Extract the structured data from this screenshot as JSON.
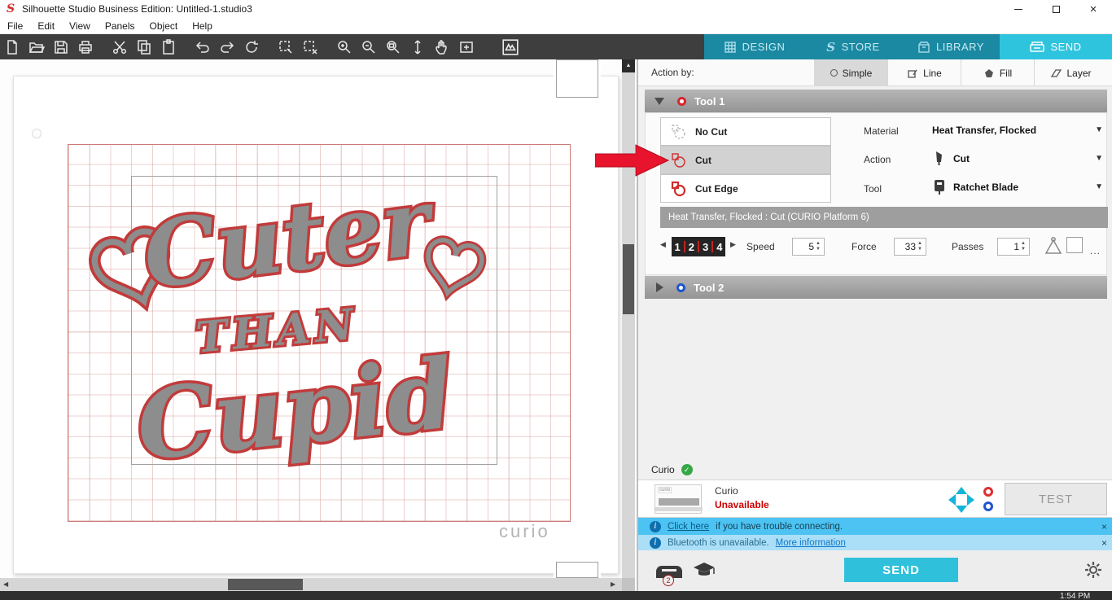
{
  "titlebar": {
    "title": "Silhouette Studio Business Edition: Untitled-1.studio3"
  },
  "menubar": {
    "items": [
      "File",
      "Edit",
      "View",
      "Panels",
      "Object",
      "Help"
    ]
  },
  "tabs": {
    "design": "DESIGN",
    "store": "STORE",
    "library": "LIBRARY",
    "send": "SEND"
  },
  "colors": {
    "accent_cyan": "#2fc1dc",
    "tab_teal": "#1b89a2",
    "alert_red": "#e8132c",
    "unavailable_red": "#cc0000",
    "design_gray": "#8d8d8d",
    "design_outline_red": "#c23b3b"
  },
  "panel": {
    "action_by_label": "Action by:",
    "action_modes": {
      "simple": "Simple",
      "line": "Line",
      "fill": "Fill",
      "layer": "Layer"
    },
    "tool1": {
      "title": "Tool 1",
      "no_cut": "No Cut",
      "cut": "Cut",
      "cut_edge": "Cut Edge",
      "material_label": "Material",
      "material_value": "Heat Transfer, Flocked",
      "action_label": "Action",
      "action_value": "Cut",
      "tool_label": "Tool",
      "tool_value": "Ratchet Blade",
      "material_bar": "Heat Transfer, Flocked : Cut (CURIO Platform 6)",
      "blade": [
        "1",
        "2",
        "3",
        "4"
      ],
      "speed_label": "Speed",
      "speed_value": "5",
      "force_label": "Force",
      "force_value": "33",
      "passes_label": "Passes",
      "passes_value": "1"
    },
    "tool2": {
      "title": "Tool 2"
    },
    "device": {
      "status_name": "Curio",
      "name": "Curio",
      "availability": "Unavailable",
      "thumb_label": "curio",
      "test_button": "TEST"
    },
    "notifications": {
      "n1_link": "Click here",
      "n1_text": "if you have trouble connecting.",
      "n2_text": "Bluetooth is unavailable.",
      "n2_link": "More information"
    },
    "footer": {
      "send_button": "SEND",
      "tool_badge": "2"
    }
  },
  "canvas": {
    "design": {
      "line1": "Cuter",
      "line2": "THAN",
      "line3": "Cupid"
    },
    "watermark": "curio"
  },
  "taskbar": {
    "time": "1:54 PM"
  },
  "icons": {
    "close": "×",
    "dismiss": "×",
    "dropdown_arrow": "▼",
    "spin_up": "▲",
    "spin_down": "▼",
    "left_arrow": "◀",
    "right_arrow": "▶",
    "up_arrow": "▲",
    "check": "✓",
    "info": "i",
    "ellipsis": "..."
  }
}
